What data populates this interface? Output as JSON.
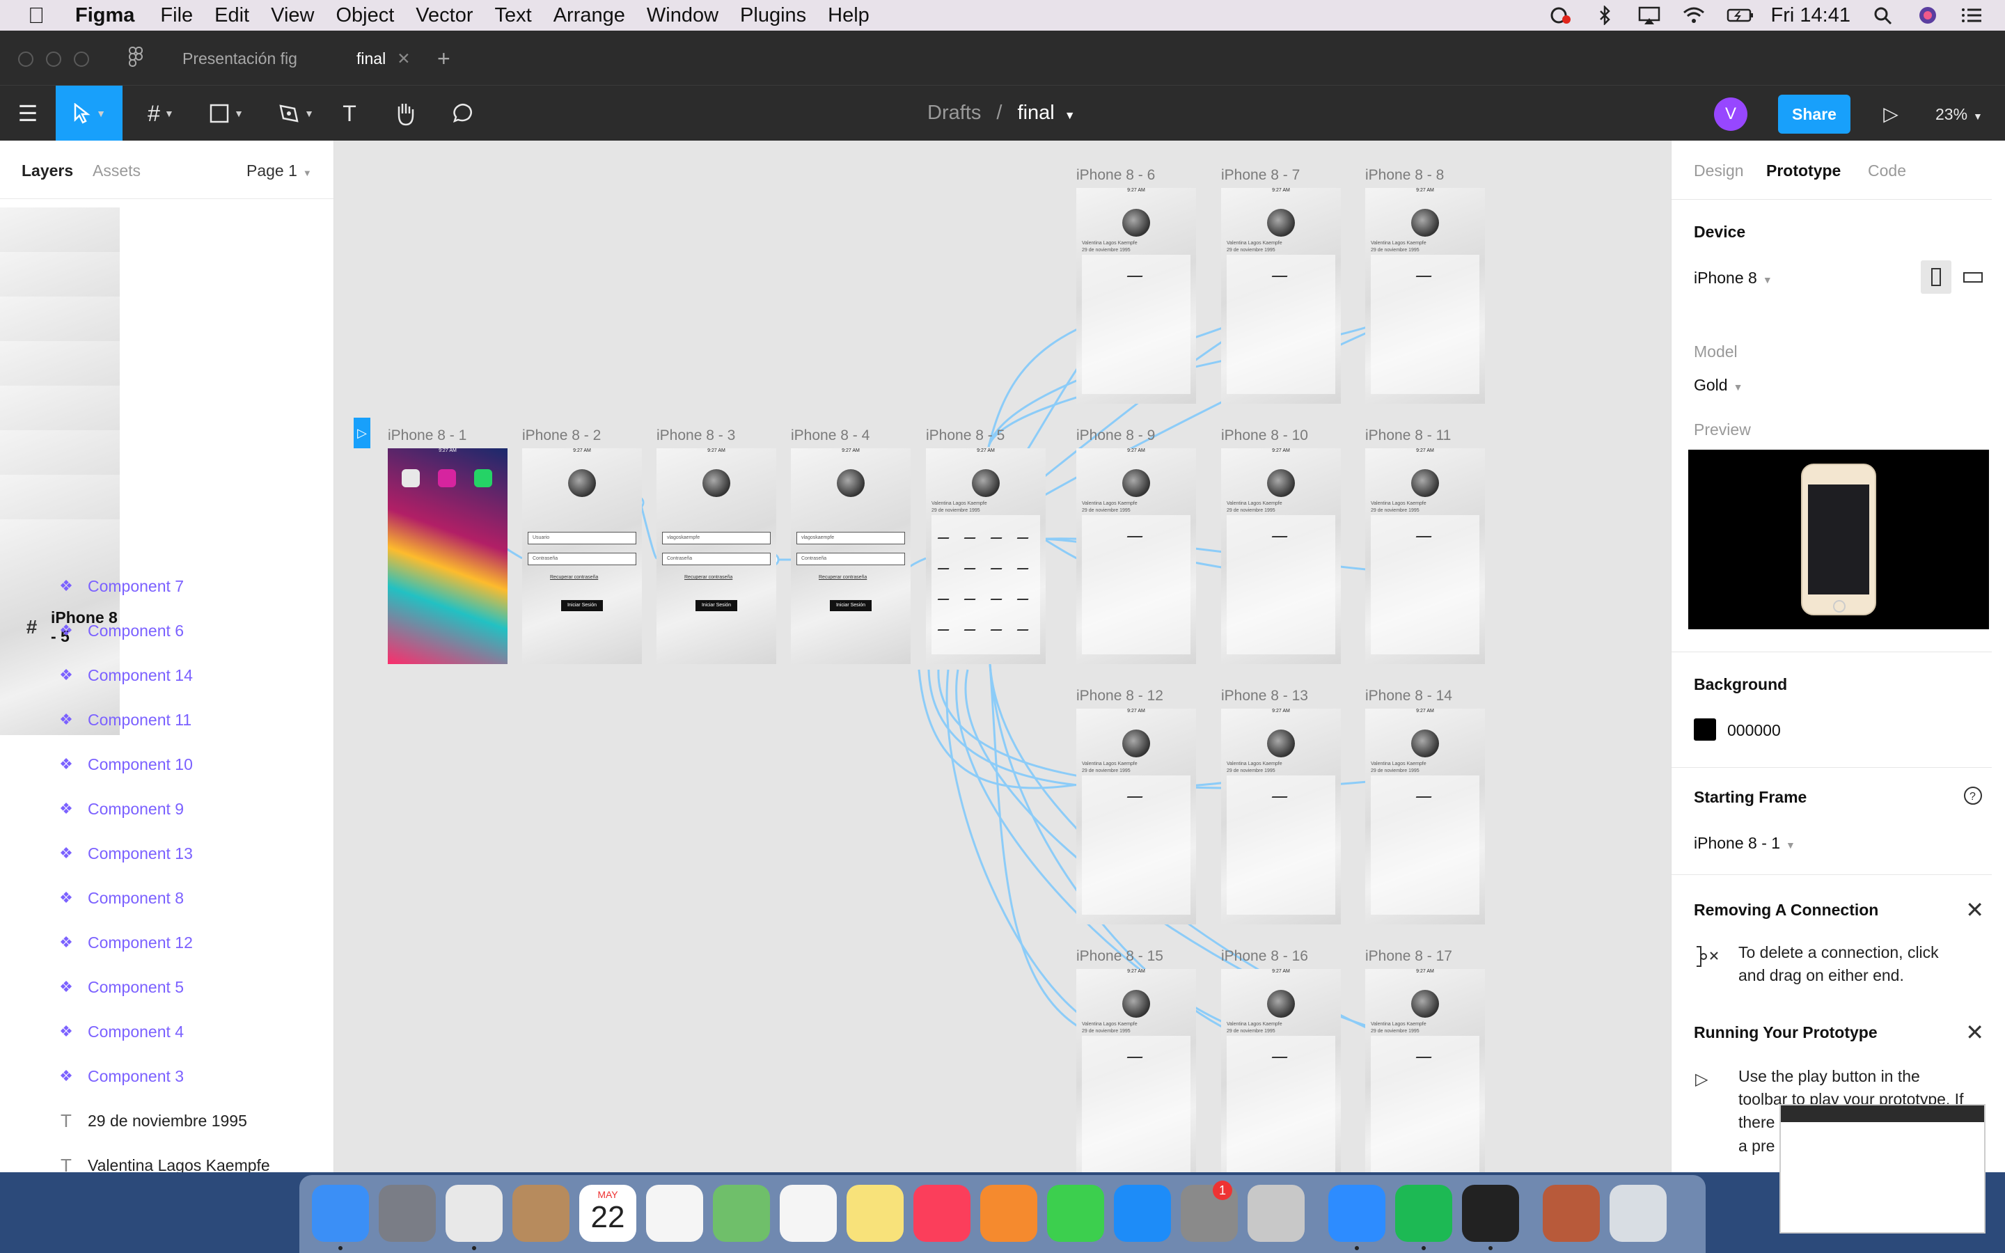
{
  "menubar": {
    "app_name": "Figma",
    "items": [
      "File",
      "Edit",
      "View",
      "Object",
      "Vector",
      "Text",
      "Arrange",
      "Window",
      "Plugins",
      "Help"
    ],
    "clock": "Fri 14:41"
  },
  "tabs": [
    {
      "label": "Presentación fig",
      "active": false
    },
    {
      "label": "final",
      "active": true
    }
  ],
  "toolbar": {
    "breadcrumb_root": "Drafts",
    "breadcrumb_sep": "/",
    "file_name": "final",
    "avatar_initial": "V",
    "share_label": "Share",
    "zoom": "23%"
  },
  "left_panel": {
    "tab_layers": "Layers",
    "tab_assets": "Assets",
    "page": "Page 1",
    "layers": [
      {
        "type": "frame",
        "name": "iPhone 8 - 14"
      },
      {
        "type": "frame",
        "name": "iPhone 8 - 13"
      },
      {
        "type": "frame",
        "name": "iPhone 8 - 12"
      },
      {
        "type": "frame",
        "name": "iPhone 8 - 10"
      },
      {
        "type": "frame",
        "name": "iPhone 8 - 9"
      },
      {
        "type": "frame",
        "name": "iPhone 8 - 8"
      },
      {
        "type": "frame",
        "name": "iPhone 8 - 6"
      },
      {
        "type": "frame",
        "name": "iPhone 8 - 5"
      },
      {
        "type": "component",
        "name": "Component 7"
      },
      {
        "type": "component",
        "name": "Component 6"
      },
      {
        "type": "component",
        "name": "Component 14"
      },
      {
        "type": "component",
        "name": "Component 11"
      },
      {
        "type": "component",
        "name": "Component 10"
      },
      {
        "type": "component",
        "name": "Component 9"
      },
      {
        "type": "component",
        "name": "Component 13"
      },
      {
        "type": "component",
        "name": "Component 8"
      },
      {
        "type": "component",
        "name": "Component 12"
      },
      {
        "type": "component",
        "name": "Component 5"
      },
      {
        "type": "component",
        "name": "Component 4"
      },
      {
        "type": "component",
        "name": "Component 3"
      },
      {
        "type": "text",
        "name": "29 de noviembre 1995"
      },
      {
        "type": "text",
        "name": "Valentina Lagos Kaempfe"
      }
    ]
  },
  "canvas": {
    "frames": [
      {
        "label": "iPhone 8 - 1",
        "kind": "home"
      },
      {
        "label": "iPhone 8 - 2",
        "kind": "login"
      },
      {
        "label": "iPhone 8 - 3",
        "kind": "login"
      },
      {
        "label": "iPhone 8 - 4",
        "kind": "login"
      },
      {
        "label": "iPhone 8 - 5",
        "kind": "grid"
      },
      {
        "label": "iPhone 8 - 6",
        "kind": "detail"
      },
      {
        "label": "iPhone 8 - 7",
        "kind": "detail"
      },
      {
        "label": "iPhone 8 - 8",
        "kind": "detail"
      },
      {
        "label": "iPhone 8 - 9",
        "kind": "detail"
      },
      {
        "label": "iPhone 8 - 10",
        "kind": "detail"
      },
      {
        "label": "iPhone 8 - 11",
        "kind": "detail"
      },
      {
        "label": "iPhone 8 - 12",
        "kind": "detail"
      },
      {
        "label": "iPhone 8 - 13",
        "kind": "detail"
      },
      {
        "label": "iPhone 8 - 14",
        "kind": "detail"
      },
      {
        "label": "iPhone 8 - 15",
        "kind": "detail"
      },
      {
        "label": "iPhone 8 - 16",
        "kind": "detail"
      },
      {
        "label": "iPhone 8 - 17",
        "kind": "detail"
      }
    ],
    "status_time": "9:27 AM",
    "field_user": "Usuario",
    "field_user_filled": "vlagoskaempfe",
    "field_password": "Contraseña",
    "login_button": "Iniciar Sesión",
    "forgot_link": "Recuperar contraseña",
    "profile_name": "Valentina Lagos Kaempfe",
    "profile_date": "29 de noviembre 1995",
    "connection_color": "#8cccf8"
  },
  "right_panel": {
    "tabs": [
      "Design",
      "Prototype",
      "Code"
    ],
    "active_tab": "Prototype",
    "device_heading": "Device",
    "device_value": "iPhone 8",
    "model_label": "Model",
    "model_value": "Gold",
    "preview_label": "Preview",
    "background_heading": "Background",
    "background_value": "000000",
    "starting_frame_heading": "Starting Frame",
    "starting_frame_value": "iPhone 8 - 1",
    "removing_heading": "Removing A Connection",
    "removing_text": "To delete a connection, click and drag on either end.",
    "running_heading": "Running Your Prototype",
    "running_text": "Use the play button in the toolbar to play your prototype. If there are no connections, the play b",
    "running_text_cont": "a pre"
  },
  "dock": {
    "apps": [
      "Finder",
      "Launchpad",
      "Chrome",
      "Mail",
      "Calendar",
      "Reminders",
      "Maps",
      "Photos",
      "Notes",
      "Music",
      "Books",
      "FaceTime",
      "App Store",
      "System Preferences",
      "Preview",
      "Zoom",
      "Spotify",
      "Figma",
      "Photo",
      "Trash"
    ],
    "calendar_month": "MAY",
    "calendar_day": "22",
    "badge_count": "1"
  }
}
